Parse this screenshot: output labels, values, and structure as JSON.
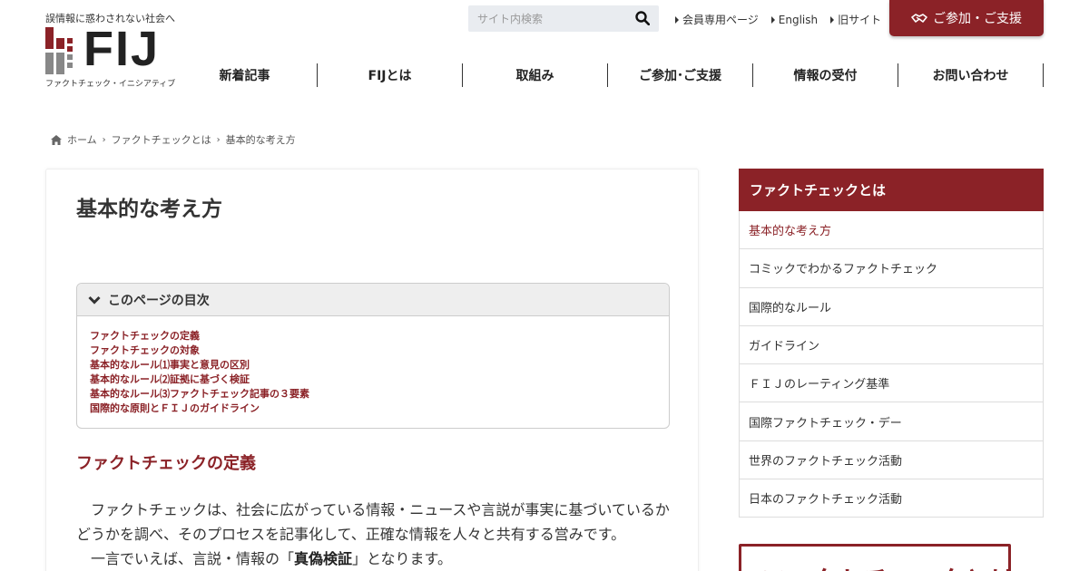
{
  "header": {
    "tagline": "誤情報に惑わされない社会へ",
    "logo_text": "FIJ",
    "logo_sub": "ファクトチェック・イニシアティブ",
    "search_placeholder": "サイト内検索",
    "top_links": [
      "会員専用ページ",
      "English",
      "旧サイト"
    ],
    "support_button": "ご参加・ご支援",
    "brand_color": "#8b2227"
  },
  "nav": [
    "新着記事",
    "FIJとは",
    "取組み",
    "ご参加･ご支援",
    "情報の受付",
    "お問い合わせ"
  ],
  "breadcrumb": {
    "home": "ホーム",
    "parent": "ファクトチェックとは",
    "current": "基本的な考え方"
  },
  "main": {
    "title": "基本的な考え方",
    "toc_title": "このページの目次",
    "toc": [
      "ファクトチェックの定義",
      "ファクトチェックの対象",
      "基本的なルール⑴事実と意見の区別",
      "基本的なルール⑵証拠に基づく検証",
      "基本的なルール⑶ファクトチェック記事の３要素",
      "国際的な原則とＦＩＪのガイドライン"
    ],
    "section_heading": "ファクトチェックの定義",
    "para1": "ファクトチェックは、社会に広がっている情報・ニュースや言説が事実に基づいているかどうかを調べ、そのプロセスを記事化して、正確な情報を人々と共有する営みです。",
    "para2_prefix": "一言でいえば、言説・情報の「",
    "para2_bold": "真偽検証",
    "para2_suffix": "」となります。"
  },
  "sidebar": {
    "heading": "ファクトチェックとは",
    "items": [
      "基本的な考え方",
      "コミックでわかるファクトチェック",
      "国際的なルール",
      "ガイドライン",
      "ＦＩＪのレーティング基準",
      "国際ファクトチェック・デー",
      "世界のファクトチェック活動",
      "日本のファクトチェック活動"
    ],
    "active_index": 0,
    "banner_text": "ファクトチェックとは"
  }
}
